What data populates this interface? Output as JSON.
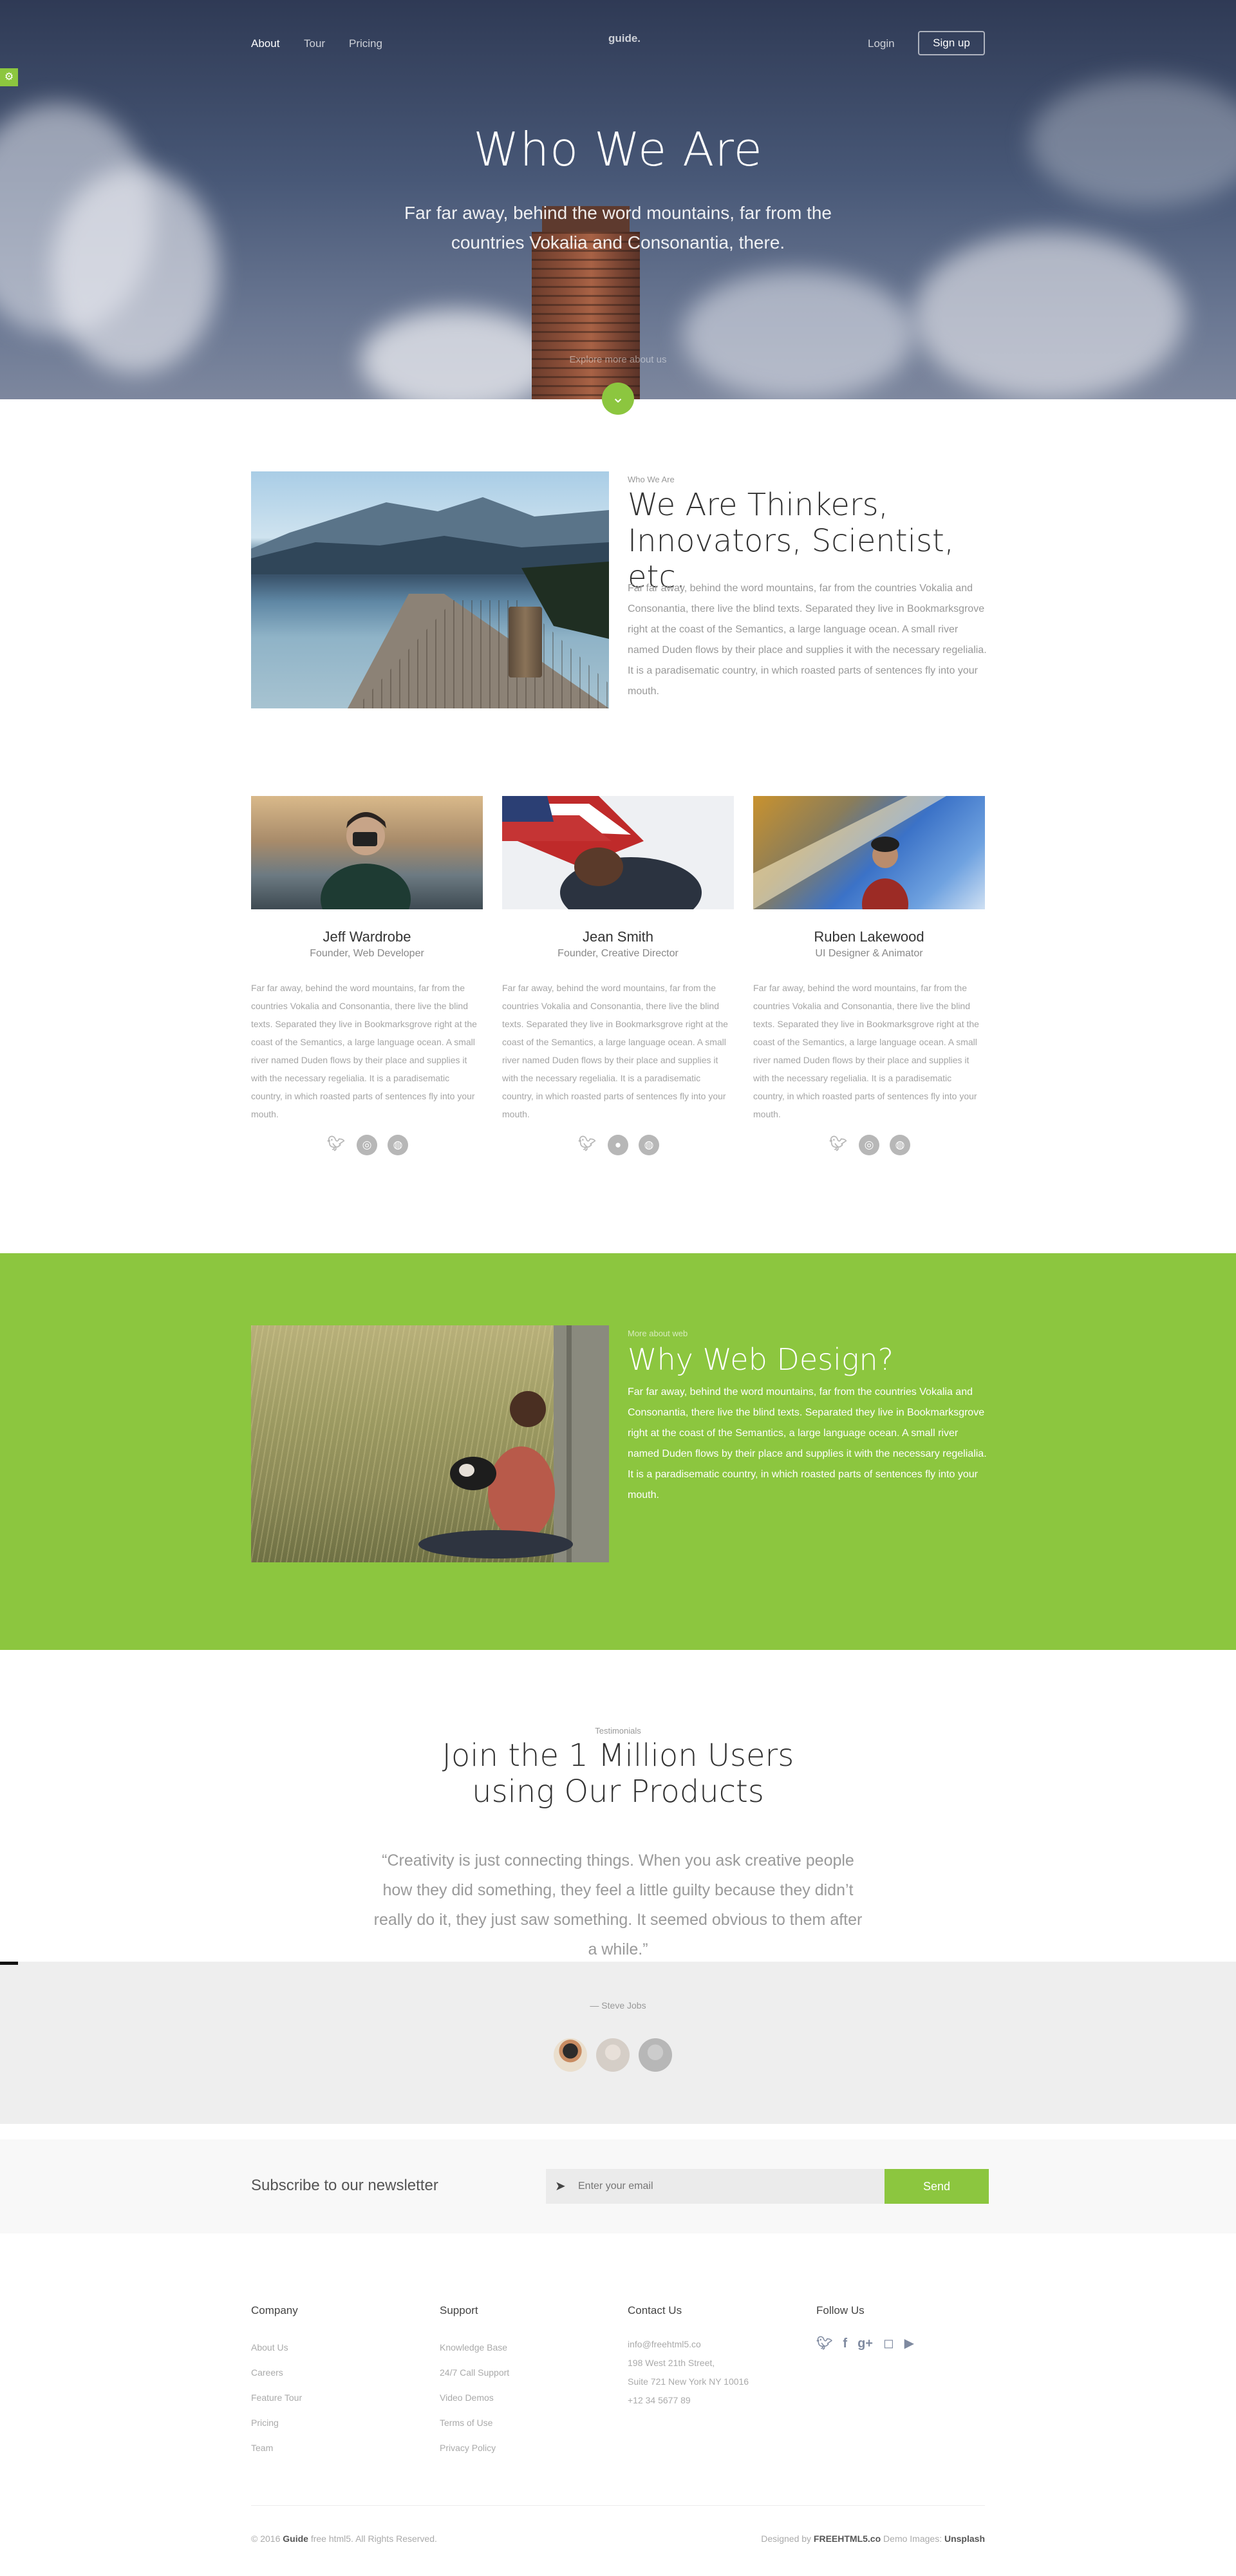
{
  "accent_color": "#8cc63f",
  "nav": {
    "links": [
      "About",
      "Tour",
      "Pricing"
    ],
    "brand": "guide.",
    "login": "Login",
    "signup": "Sign up"
  },
  "hero": {
    "title": "Who We Are",
    "subtitle": "Far far away, behind the word mountains, far from the countries Vokalia and Consonantia, there.",
    "explore": "Explore more about us"
  },
  "about": {
    "eyebrow": "Who We Are",
    "title": "We Are Thinkers, Innovators, Scientist, etc.",
    "text": "Far far away, behind the word mountains, far from the countries Vokalia and Consonantia, there live the blind texts. Separated they live in Bookmarksgrove right at the coast of the Semantics, a large language ocean. A small river named Duden flows by their place and supplies it with the necessary regelialia. It is a paradisematic country, in which roasted parts of sentences fly into your mouth."
  },
  "team": [
    {
      "name": "Jeff Wardrobe",
      "role": "Founder, Web Developer",
      "bio": "Far far away, behind the word mountains, far from the countries Vokalia and Consonantia, there live the blind texts. Separated they live in Bookmarksgrove right at the coast of the Semantics, a large language ocean. A small river named Duden flows by their place and supplies it with the necessary regelialia. It is a paradisematic country, in which roasted parts of sentences fly into your mouth.",
      "social": [
        "twitter-icon",
        "dribbble-icon",
        "globe-icon"
      ]
    },
    {
      "name": "Jean Smith",
      "role": "Founder, Creative Director",
      "bio": "Far far away, behind the word mountains, far from the countries Vokalia and Consonantia, there live the blind texts. Separated they live in Bookmarksgrove right at the coast of the Semantics, a large language ocean. A small river named Duden flows by their place and supplies it with the necessary regelialia. It is a paradisematic country, in which roasted parts of sentences fly into your mouth.",
      "social": [
        "twitter-icon",
        "github-icon",
        "globe-icon"
      ]
    },
    {
      "name": "Ruben Lakewood",
      "role": "UI Designer & Animator",
      "bio": "Far far away, behind the word mountains, far from the countries Vokalia and Consonantia, there live the blind texts. Separated they live in Bookmarksgrove right at the coast of the Semantics, a large language ocean. A small river named Duden flows by their place and supplies it with the necessary regelialia. It is a paradisematic country, in which roasted parts of sentences fly into your mouth.",
      "social": [
        "twitter-icon",
        "dribbble-icon",
        "globe-icon"
      ]
    }
  ],
  "feature": {
    "eyebrow": "More about web",
    "title": "Why Web Design?",
    "text": "Far far away, behind the word mountains, far from the countries Vokalia and Consonantia, there live the blind texts. Separated they live in Bookmarksgrove right at the coast of the Semantics, a large language ocean. A small river named Duden flows by their place and supplies it with the necessary regelialia. It is a paradisematic country, in which roasted parts of sentences fly into your mouth."
  },
  "testimonials": {
    "eyebrow": "Testimonials",
    "title_line1": "Join the 1 Million Users",
    "title_line2": "using Our Products",
    "quote": "“Creativity is just connecting things. When you ask creative people how they did something, they feel a little guilty because they didn’t really do it, they just saw something. It seemed obvious to them after a while.”",
    "author": "— Steve Jobs"
  },
  "newsletter": {
    "label": "Subscribe to our newsletter",
    "placeholder": "Enter your email",
    "button": "Send"
  },
  "footer": {
    "company": {
      "heading": "Company",
      "links": [
        "About Us",
        "Careers",
        "Feature Tour",
        "Pricing",
        "Team"
      ]
    },
    "support": {
      "heading": "Support",
      "links": [
        "Knowledge Base",
        "24/7 Call Support",
        "Video Demos",
        "Terms of Use",
        "Privacy Policy"
      ]
    },
    "contact": {
      "heading": "Contact Us",
      "lines": [
        "info@freehtml5.co",
        "198 West 21th Street,",
        "Suite 721 New York NY 10016",
        "+12 34 5677 89"
      ]
    },
    "follow": {
      "heading": "Follow Us",
      "icons": [
        "twitter-icon",
        "facebook-icon",
        "google-plus-icon",
        "instagram-icon",
        "youtube-icon"
      ]
    },
    "copyright_prefix": "© 2016",
    "copyright_brand": "Guide",
    "copyright_suffix": "free html5. All Rights Reserved.",
    "credit_prefix": "Designed by",
    "credit_brand": "FREEHTML5.co",
    "credit_mid": "Demo Images:",
    "credit_images": "Unsplash"
  }
}
